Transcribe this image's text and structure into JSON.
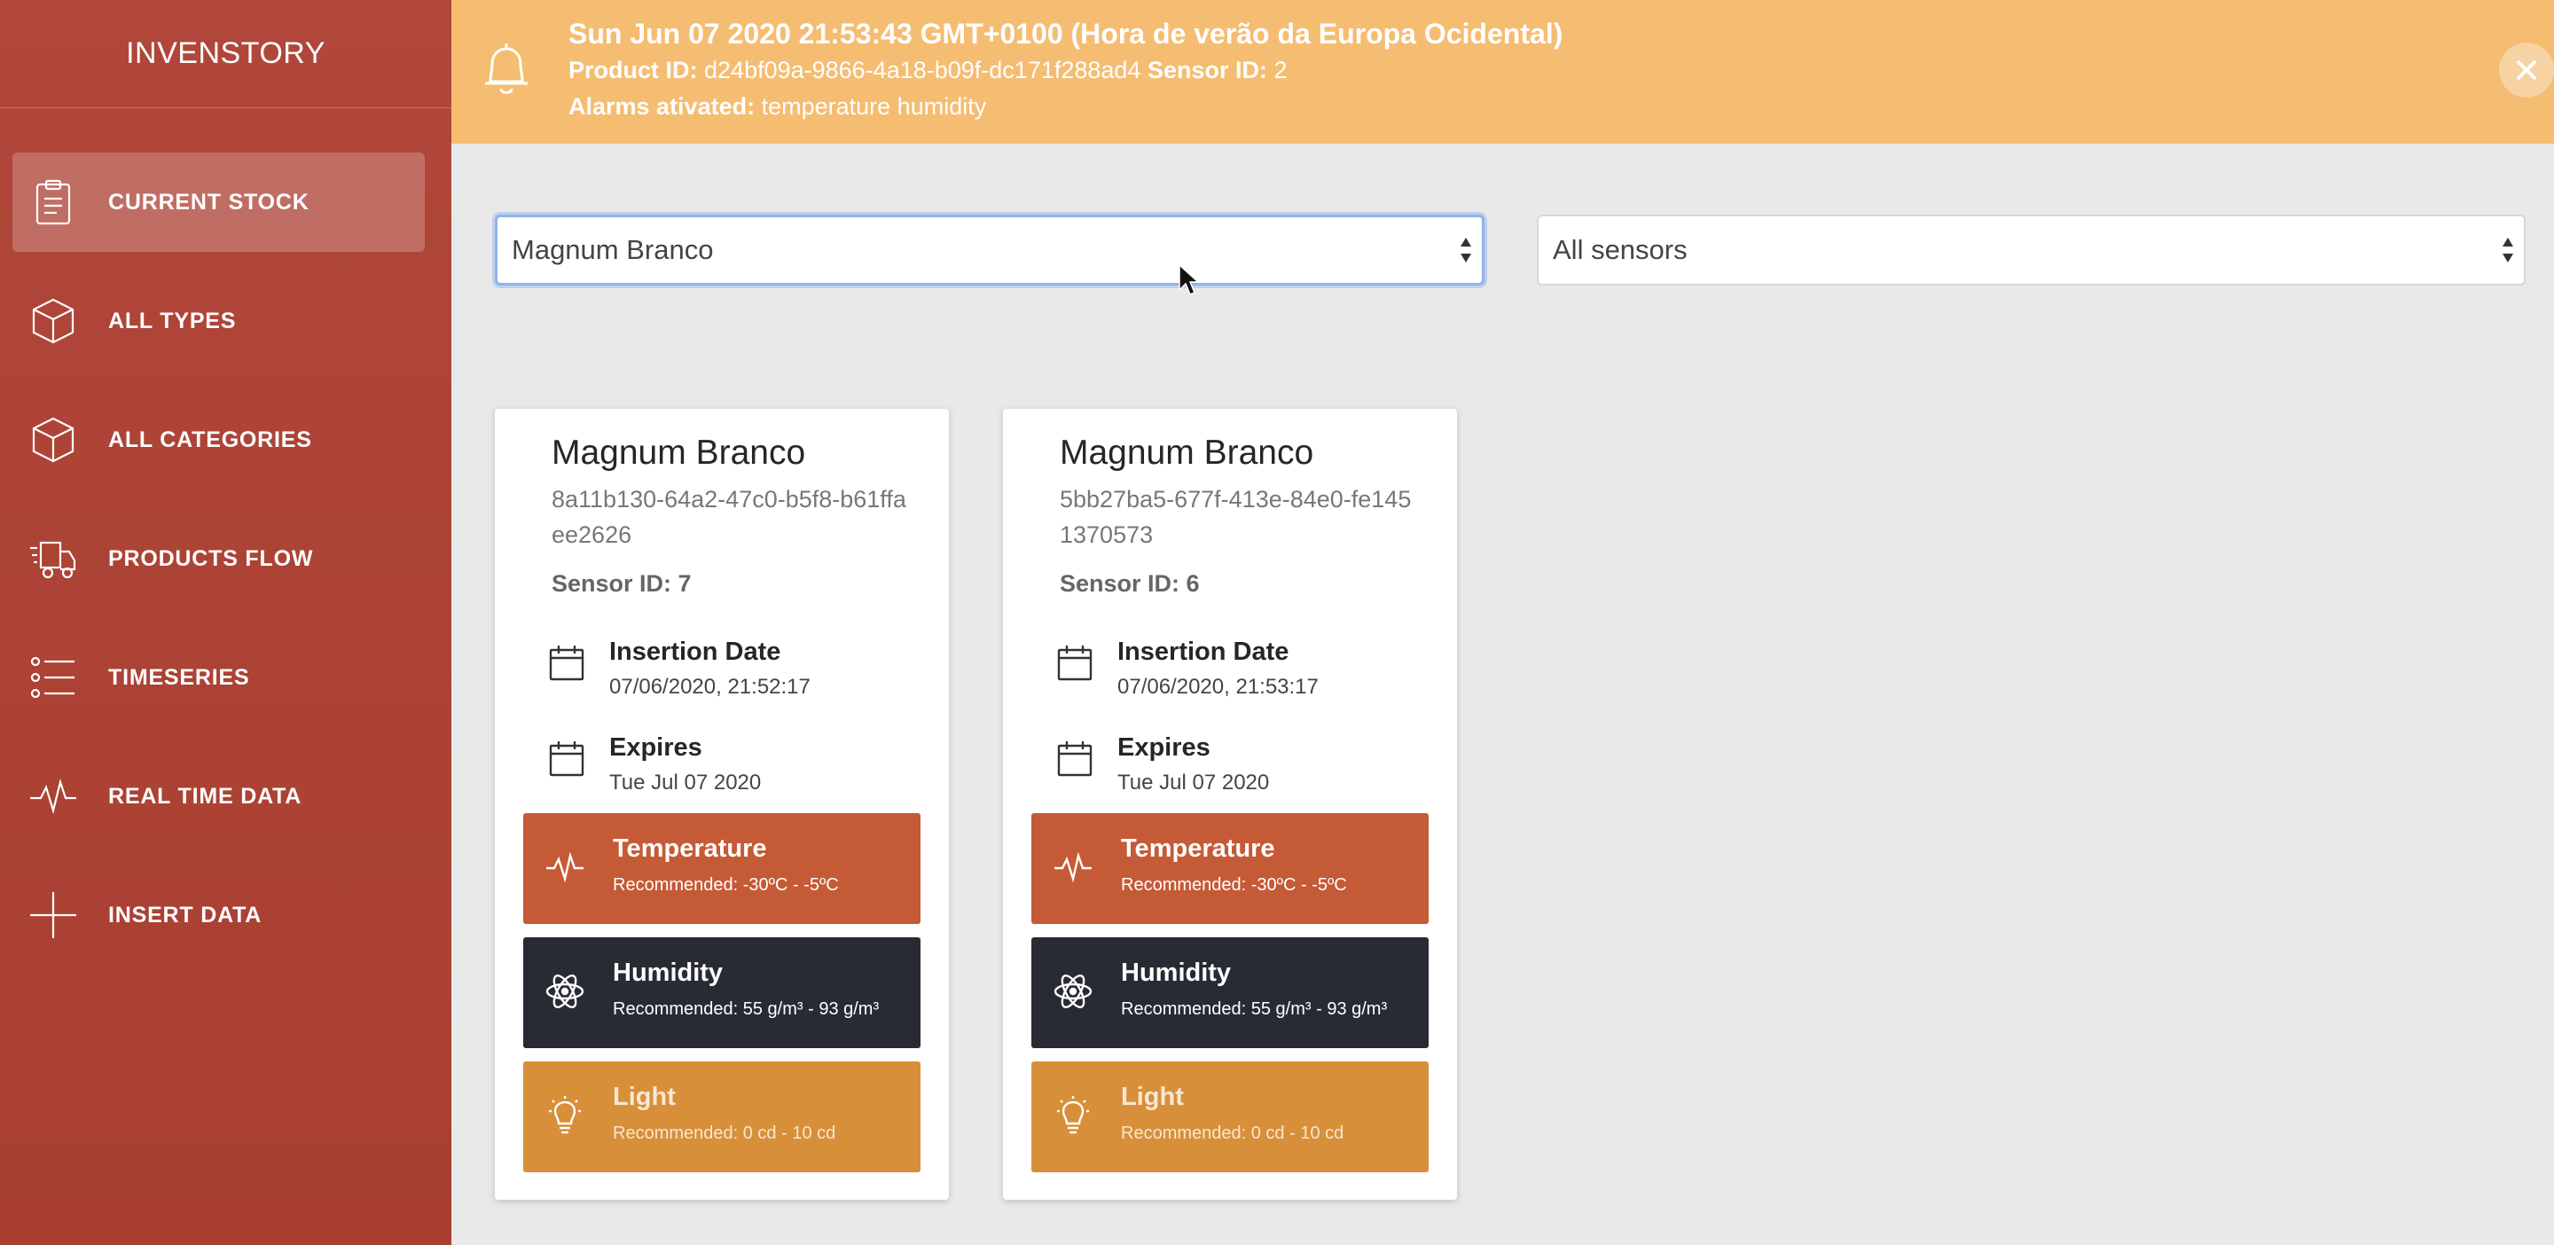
{
  "app": {
    "title": "INVENSTORY"
  },
  "sidebar": {
    "items": [
      {
        "label": "CURRENT STOCK",
        "icon": "clipboard-icon",
        "active": true
      },
      {
        "label": "ALL TYPES",
        "icon": "cube-icon"
      },
      {
        "label": "ALL CATEGORIES",
        "icon": "cube-icon"
      },
      {
        "label": "PRODUCTS FLOW",
        "icon": "truck-icon"
      },
      {
        "label": "TIMESERIES",
        "icon": "list-icon"
      },
      {
        "label": "REAL TIME DATA",
        "icon": "pulse-icon"
      },
      {
        "label": "INSERT DATA",
        "icon": "plus-icon"
      }
    ]
  },
  "alert": {
    "title": "Sun Jun 07 2020 21:53:43 GMT+0100 (Hora de verão da Europa Ocidental)",
    "product_label": "Product ID:",
    "product_value": "d24bf09a-9866-4a18-b09f-dc171f288ad4",
    "sensor_label": "Sensor ID:",
    "sensor_value": "2",
    "alarms_label": "Alarms ativated:",
    "alarms_value": "temperature humidity",
    "bg_color": "#f5bd72"
  },
  "filters": {
    "product_select": "Magnum Branco",
    "sensor_select": "All sensors"
  },
  "cards": [
    {
      "name": "Magnum Branco",
      "id": "8a11b130-64a2-47c0-b5f8-b61ffaee2626",
      "sensor_label": "Sensor ID:",
      "sensor_value": "7",
      "insertion_label": "Insertion Date",
      "insertion_value": "07/06/2020, 21:52:17",
      "expires_label": "Expires",
      "expires_value": "Tue Jul 07 2020",
      "temperature": {
        "label": "Temperature",
        "recommended": "Recommended: -30ºC - -5ºC"
      },
      "humidity": {
        "label": "Humidity",
        "recommended": "Recommended: 55 g/m³ - 93 g/m³"
      },
      "light": {
        "label": "Light",
        "recommended": "Recommended: 0 cd - 10 cd"
      }
    },
    {
      "name": "Magnum Branco",
      "id": "5bb27ba5-677f-413e-84e0-fe1451370573",
      "sensor_label": "Sensor ID:",
      "sensor_value": "6",
      "insertion_label": "Insertion Date",
      "insertion_value": "07/06/2020, 21:53:17",
      "expires_label": "Expires",
      "expires_value": "Tue Jul 07 2020",
      "temperature": {
        "label": "Temperature",
        "recommended": "Recommended: -30ºC - -5ºC"
      },
      "humidity": {
        "label": "Humidity",
        "recommended": "Recommended: 55 g/m³ - 93 g/m³"
      },
      "light": {
        "label": "Light",
        "recommended": "Recommended: 0 cd - 10 cd"
      }
    }
  ],
  "colors": {
    "sidebar": "#b04436",
    "temperature": "#c55a36",
    "humidity": "#282b33",
    "light": "#d88f3a"
  }
}
